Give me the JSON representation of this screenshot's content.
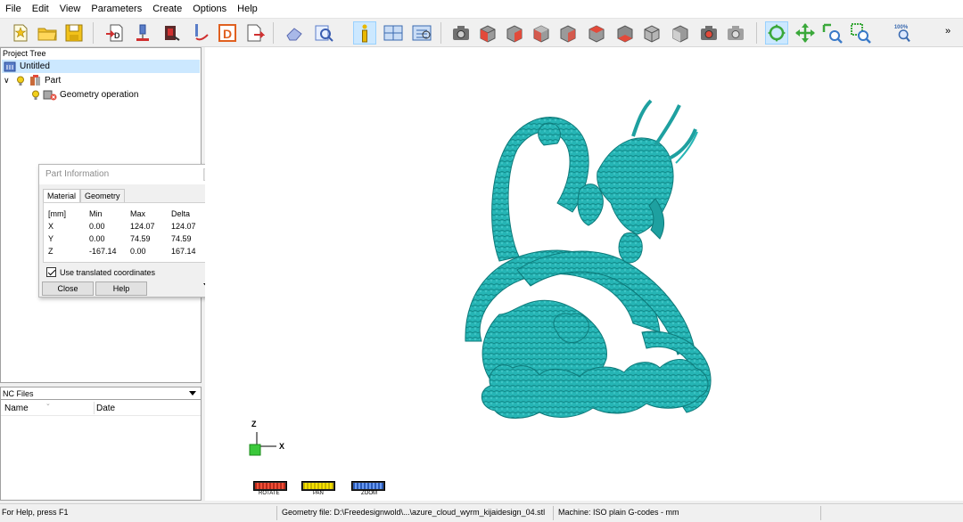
{
  "menu": [
    "File",
    "Edit",
    "View",
    "Parameters",
    "Create",
    "Options",
    "Help"
  ],
  "toolbar": {
    "zoom_label": "100%",
    "overflow": "»",
    "colors": {
      "shaded": "#6e6e6e",
      "red_face": "#e24a3a",
      "active_bg": "#cce8ff"
    }
  },
  "project_tree": {
    "header": "Project Tree",
    "root": "Untitled",
    "part": "Part",
    "operation": "Geometry operation"
  },
  "nc_files": {
    "header": "NC Files",
    "columns": [
      "Name",
      "Date"
    ]
  },
  "part_info": {
    "title": "Part Information",
    "tabs": [
      "Material",
      "Geometry"
    ],
    "table": {
      "headers": [
        "[mm]",
        "Min",
        "Max",
        "Delta"
      ],
      "rows": [
        [
          "X",
          "0.00",
          "124.07",
          "124.07"
        ],
        [
          "Y",
          "0.00",
          "74.59",
          "74.59"
        ],
        [
          "Z",
          "-167.14",
          "0.00",
          "167.14"
        ]
      ]
    },
    "checkbox_label": "Use translated coordinates",
    "close_label": "Close",
    "help_label": "Help"
  },
  "viewport": {
    "model_color": "#26b5b5",
    "axis_z": "Z",
    "axis_x": "X",
    "controls": [
      "ROTATE",
      "PAN",
      "ZOOM"
    ]
  },
  "status": {
    "help": "For Help, press F1",
    "geometry": "Geometry file: D:\\Freedesignwold\\...\\azure_cloud_wyrm_kijaidesign_04.stl",
    "machine": "Machine: ISO plain G-codes - mm"
  }
}
